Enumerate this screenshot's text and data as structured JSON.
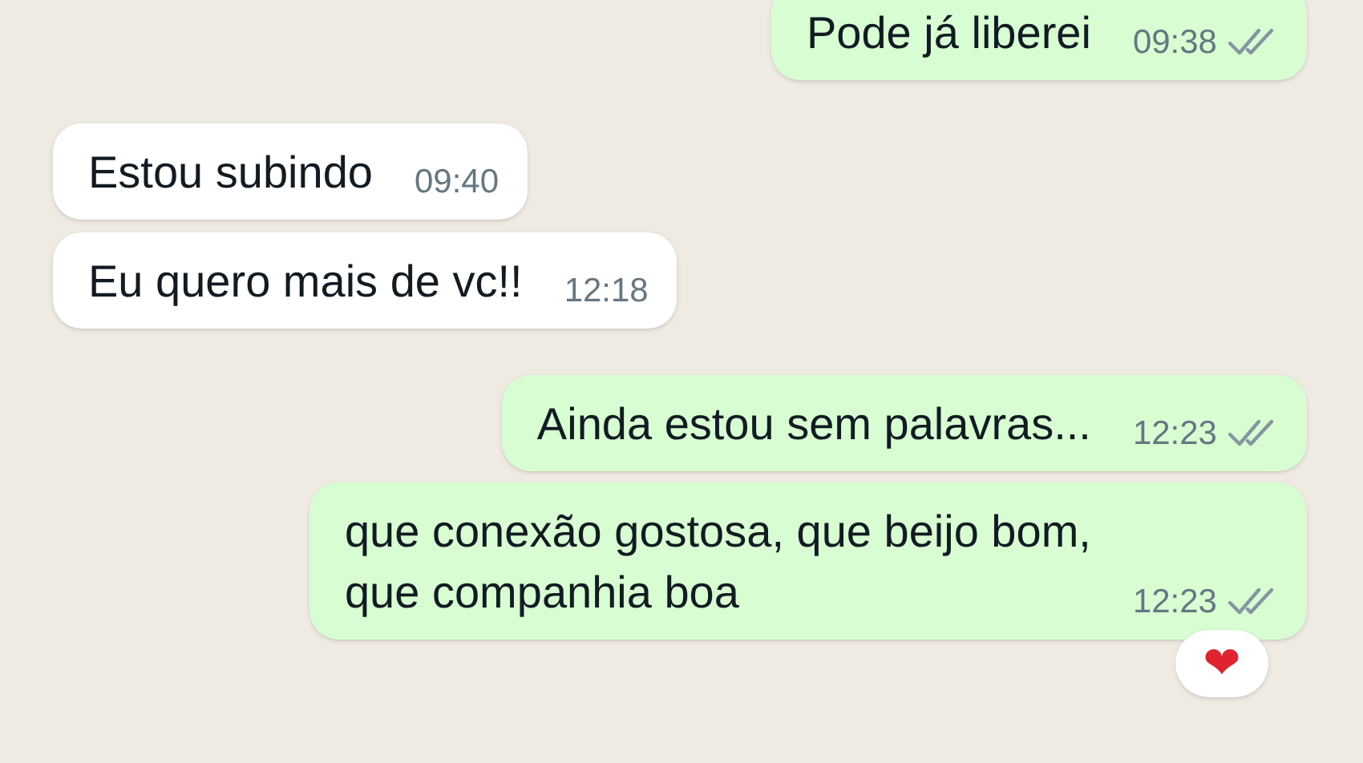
{
  "messages": [
    {
      "kind": "outgoing",
      "text": "Pode já liberei",
      "time": "09:38",
      "read": false
    },
    {
      "kind": "incoming",
      "text": "Estou subindo",
      "time": "09:40"
    },
    {
      "kind": "incoming",
      "text": "Eu quero mais de vc!!",
      "time": "12:18"
    },
    {
      "kind": "outgoing",
      "text": "Ainda estou sem palavras...",
      "time": "12:23",
      "read": false
    },
    {
      "kind": "outgoing",
      "text": "que conexão gostosa, que beijo bom,\nque companhia boa",
      "time": "12:23",
      "read": false,
      "reaction": "❤"
    }
  ]
}
